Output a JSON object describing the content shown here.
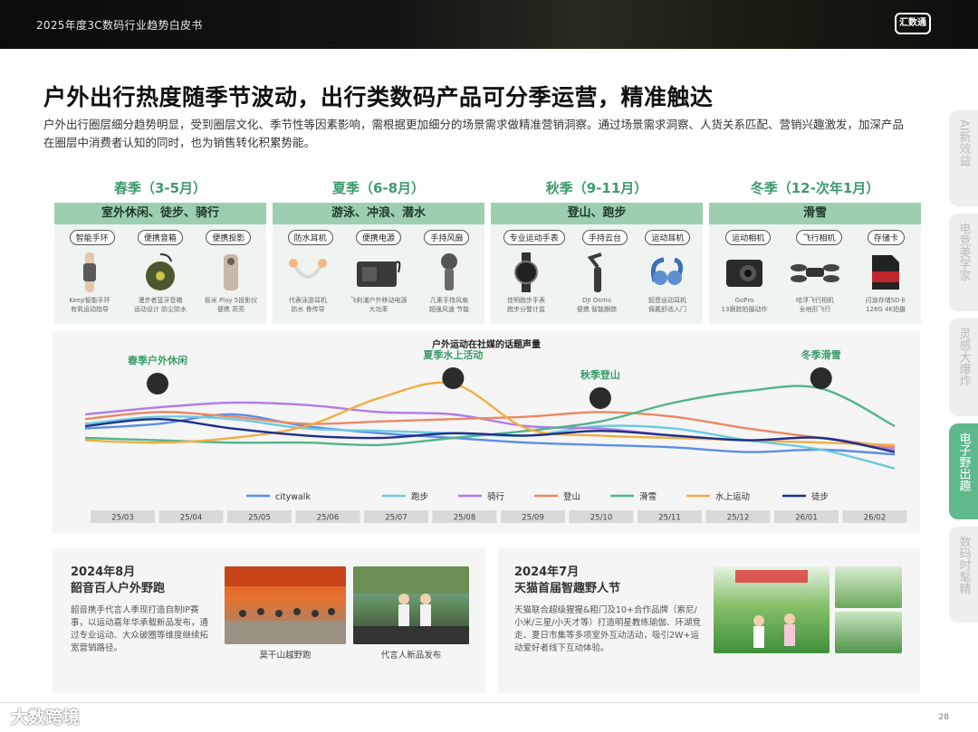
{
  "header": {
    "title": "2025年度3C数码行业趋势白皮书",
    "logo_text": "汇数通"
  },
  "main": {
    "title": "户外出行热度随季节波动，出行类数码产品可分季运营，精准触达",
    "description": "户外出行圈层细分趋势明显，受到圈层文化、季节性等因素影响，需根据更加细分的场景需求做精准营销洞察。通过场景需求洞察、人货关系匹配、营销兴趣激发，加深产品在圈层中消费者认知的同时，也为销售转化积累势能。"
  },
  "sidebar": {
    "tabs": [
      {
        "label": "AI新效益",
        "active": false
      },
      {
        "label": "电竞美学家",
        "active": false
      },
      {
        "label": "灵感大爆炸",
        "active": false
      },
      {
        "label": "电子野出趣",
        "active": true
      },
      {
        "label": "数码时髦精",
        "active": false
      }
    ]
  },
  "seasons": [
    {
      "label": "春季（3-5月）",
      "activities": "室外休闲、徒步、骑行",
      "products": [
        {
          "tag": "智能手环",
          "caption": "Keep智能手环\n有氧运动指导",
          "icon": "band-icon"
        },
        {
          "tag": "便携音箱",
          "caption": "漫步者蓝牙音箱\n运动设计 防尘防水",
          "icon": "speaker-icon"
        },
        {
          "tag": "便携投影",
          "caption": "极米 Play 5投影仪\n便携 高亮",
          "icon": "projector-icon"
        }
      ]
    },
    {
      "label": "夏季（6-8月）",
      "activities": "游泳、冲浪、潜水",
      "products": [
        {
          "tag": "防水耳机",
          "caption": "代表泳游耳机\n防水 骨传导",
          "icon": "bone-earphone-icon"
        },
        {
          "tag": "便携电源",
          "caption": "飞利浦户外移动电源\n大功率",
          "icon": "power-bank-icon"
        },
        {
          "tag": "手持风扇",
          "caption": "几素手持风扇\n超强风速 节能",
          "icon": "handheld-fan-icon"
        }
      ]
    },
    {
      "label": "秋季（9-11月）",
      "activities": "登山、跑步",
      "products": [
        {
          "tag": "专业运动手表",
          "caption": "佳明跑步手表\n跑步分警计监",
          "icon": "watch-icon"
        },
        {
          "tag": "手持云台",
          "caption": "DJI Osmo\n便携 智能跟踪",
          "icon": "gimbal-icon"
        },
        {
          "tag": "运动耳机",
          "caption": "韶音运动耳机\n佩戴舒适入门",
          "icon": "sport-earphone-icon"
        }
      ]
    },
    {
      "label": "冬季（12-次年1月）",
      "activities": "滑雪",
      "products": [
        {
          "tag": "运动相机",
          "caption": "GoPro\n13跟踪拍摄动作",
          "icon": "action-camera-icon"
        },
        {
          "tag": "飞行相机",
          "caption": "哈浮飞行相机\n全地形飞行",
          "icon": "drone-icon"
        },
        {
          "tag": "存储卡",
          "caption": "闪迪存储SD卡\n128G 4K拍摄",
          "icon": "sd-card-icon"
        }
      ]
    }
  ],
  "chart_data": {
    "type": "line",
    "title": "户外运动在社媒的话题声量",
    "x": [
      "25/03",
      "25/04",
      "25/05",
      "25/06",
      "25/07",
      "25/08",
      "25/09",
      "25/10",
      "25/11",
      "25/12",
      "26/01",
      "26/02"
    ],
    "series": [
      {
        "name": "citywalk",
        "color": "#5b8ee6",
        "values": [
          48,
          52,
          60,
          50,
          44,
          40,
          36,
          34,
          32,
          28,
          30,
          26
        ]
      },
      {
        "name": "跑步",
        "color": "#6ccbe0",
        "values": [
          52,
          58,
          56,
          48,
          46,
          44,
          42,
          50,
          48,
          38,
          30,
          14
        ]
      },
      {
        "name": "骑行",
        "color": "#b37ae8",
        "values": [
          60,
          66,
          70,
          68,
          62,
          60,
          50,
          48,
          42,
          38,
          40,
          30
        ]
      },
      {
        "name": "登山",
        "color": "#ea8865",
        "values": [
          56,
          62,
          58,
          52,
          54,
          56,
          58,
          62,
          58,
          48,
          40,
          32
        ]
      },
      {
        "name": "滑雪",
        "color": "#52b48a",
        "values": [
          40,
          38,
          36,
          36,
          34,
          40,
          46,
          54,
          70,
          80,
          82,
          50
        ]
      },
      {
        "name": "水上运动",
        "color": "#f0ae44",
        "values": [
          38,
          36,
          40,
          50,
          74,
          86,
          48,
          42,
          40,
          38,
          36,
          34
        ]
      },
      {
        "name": "徒步",
        "color": "#1f2f8a",
        "values": [
          50,
          56,
          48,
          42,
          40,
          44,
          42,
          46,
          42,
          38,
          40,
          28
        ]
      }
    ],
    "annotations": [
      {
        "text": "春季户外休闲",
        "x": "25/03"
      },
      {
        "text": "夏季水上活动",
        "x": "25/08"
      },
      {
        "text": "秋季登山",
        "x": "25/10"
      },
      {
        "text": "冬季滑雪",
        "x": "26/01"
      }
    ],
    "legend": "bottom",
    "grid": false
  },
  "cases": [
    {
      "date": "2024年8月",
      "title": "韶音百人户外野跑",
      "text": "韶音携手代言人季现打造自制IP赛事，以运动嘉年华承载新品发布，通过专业运动、大众破圈等维度继续拓宽营销路径。",
      "photos": [
        "莫干山越野跑",
        "代言人新品发布"
      ]
    },
    {
      "date": "2024年7月",
      "title": "天猫首届智趣野人节",
      "text": "天猫联合超级猩猩&粗门及10+合作品牌（索尼/小米/三星/小天才等）打造明星教练瑜伽、环湖竞走、夏日市集等多项室外互动活动，吸引2W+运动爱好者线下互动体验。",
      "photos": []
    }
  ],
  "footer": {
    "brand": "大数跨境",
    "page": "28"
  }
}
